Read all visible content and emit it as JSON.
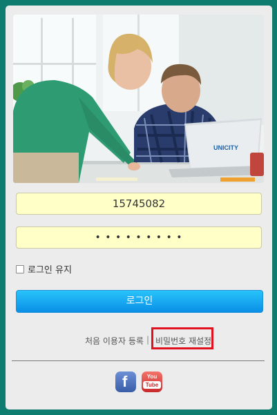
{
  "login": {
    "username_value": "15745082",
    "password_mask": "• • • • • • • • •",
    "remember_label": "로그인 유지",
    "login_button": "로그인"
  },
  "links": {
    "register": "처음 이용자 등록",
    "separator": "|",
    "reset_password": "비밀번호 재설정"
  },
  "photo": {
    "laptop_text": "UNICITY"
  },
  "social": {
    "facebook": "f",
    "youtube_top": "You",
    "youtube_bottom": "Tube"
  },
  "colors": {
    "background": "#0e7d6f",
    "field": "#ffffc8",
    "button_top": "#28c3fb",
    "button_bottom": "#0a8fe6",
    "highlight": "#e0101e"
  },
  "icons": {
    "facebook": "facebook-icon",
    "youtube": "youtube-icon"
  }
}
